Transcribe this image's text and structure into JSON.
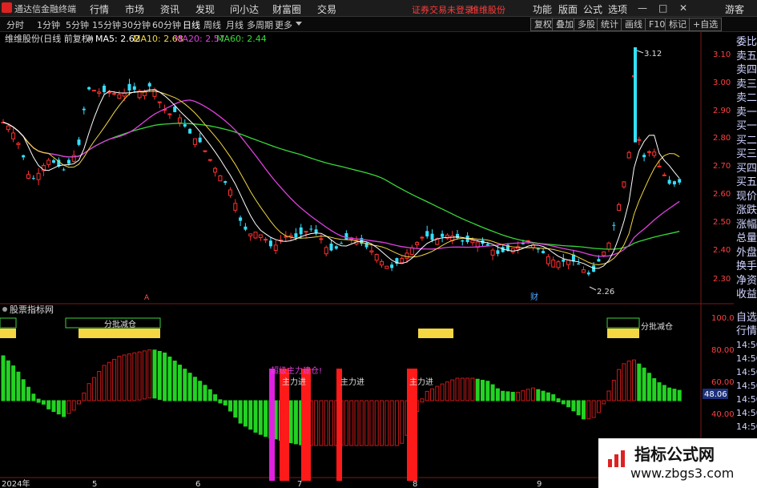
{
  "menubar": {
    "app_title": "通达信金融终端",
    "items": [
      "行情",
      "市场",
      "资讯",
      "发现",
      "问小达",
      "财富圈",
      "交易"
    ],
    "notice": "证券交易未登录",
    "stock_link": "维维股份",
    "right_items": [
      "功能",
      "版面",
      "公式",
      "选项"
    ],
    "guest": "游客",
    "window_controls": [
      "—",
      "□",
      "✕"
    ]
  },
  "toolbar": {
    "periods": [
      "分时",
      "1分钟",
      "5分钟",
      "15分钟",
      "30分钟",
      "60分钟",
      "日线",
      "周线",
      "月线",
      "多周期",
      "更多"
    ],
    "active_period": "日线",
    "right_buttons": [
      "复权",
      "叠加",
      "多股",
      "统计",
      "画线",
      "F10",
      "标记",
      "+自选"
    ]
  },
  "main_chart": {
    "title": "维维股份(日线 前复权)",
    "legend": [
      {
        "label": "MA5: 2.62",
        "color": "#ffffff"
      },
      {
        "label": "MA10: 2.68",
        "color": "#f4d742"
      },
      {
        "label": "MA20: 2.57",
        "color": "#e040e0"
      },
      {
        "label": "MA60: 2.44",
        "color": "#38d838"
      }
    ],
    "high_label": "3.12",
    "low_label": "2.26",
    "marker_cai": "财",
    "marker_a": "A",
    "y_ticks": [
      "3.10",
      "3.00",
      "2.90",
      "2.80",
      "2.70",
      "2.60",
      "2.50",
      "2.40",
      "2.30"
    ]
  },
  "indicator": {
    "title": "股票指标网",
    "annotations": {
      "reduce1": "分批减仓",
      "reduce2": "分批减仓",
      "build": "超级主力建仓!",
      "enter": [
        "主力进",
        "主力进",
        "主力进"
      ]
    },
    "y_ticks": [
      "100.00",
      "80.00",
      "60.00",
      "40.00"
    ],
    "current_value": "48.06"
  },
  "right_panel": {
    "items": [
      "委比",
      "卖五",
      "卖四",
      "卖三",
      "卖二",
      "卖一",
      "买一",
      "买二",
      "买三",
      "买四",
      "买五",
      "现价",
      "涨跌",
      "涨幅",
      "总量",
      "外盘",
      "换手",
      "净资",
      "收益"
    ],
    "lower_items": [
      "自选",
      "行情",
      "14:50",
      "14:50",
      "14:50",
      "14:50",
      "14:50",
      "14:50",
      "14:50"
    ]
  },
  "x_axis": {
    "labels": [
      "2024年",
      "5",
      "6",
      "7",
      "8",
      "9"
    ]
  },
  "watermark": {
    "line1": "指标公式网",
    "line2": "www.zbgs3.com"
  },
  "colors": {
    "up": "#ff3030",
    "down": "#33e0ff",
    "ma5": "#ffffff",
    "ma10": "#f4d742",
    "ma20": "#e040e0",
    "ma60": "#38d838",
    "bar_red": "#cc1a1a",
    "bar_green": "#22d322",
    "bar_pink": "#e020e0"
  }
}
